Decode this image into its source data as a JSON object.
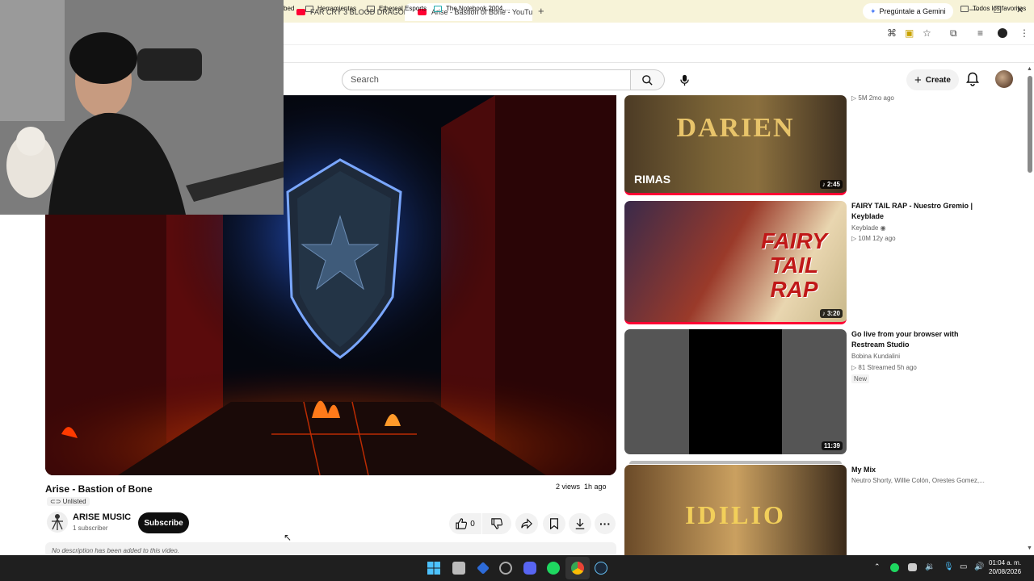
{
  "browser": {
    "tabs": [
      {
        "label": "FAR CRY 3 BLOOD DRAGON Ga",
        "active": false
      },
      {
        "label": "Arise - Bastion of Bone - YouTu",
        "active": true
      }
    ],
    "gemini_button": "Pregúntale a Gemini",
    "bookmarks": [
      "bed",
      "Herramientas",
      "Ethereal Esports",
      "The.Notebook.2004...."
    ],
    "all_bookmarks": "Todos los favoritos"
  },
  "youtube": {
    "search_placeholder": "Search",
    "create_label": "Create"
  },
  "video": {
    "title": "Arise - Bastion of Bone",
    "views": "2 views",
    "age": "1h ago",
    "visibility": "Unlisted",
    "channel": "ARISE MUSIC",
    "subscribers": "1 subscriber",
    "subscribe_label": "Subscribe",
    "likes": "0",
    "description": "No description has been added to this video."
  },
  "recommendations": [
    {
      "thumb_text": "DARIEN",
      "thumb_sub": "RIMAS",
      "duration": "2:45",
      "title": "",
      "channel": "",
      "meta": "5M  2mo ago"
    },
    {
      "thumb_text": "FAIRY TAIL RAP",
      "duration": "3:20",
      "title": "FAIRY TAIL RAP - Nuestro Gremio | Keyblade",
      "channel": "Keyblade",
      "meta": "10M  12y ago"
    },
    {
      "duration": "11:39",
      "title": "Go live from your browser with Restream Studio",
      "channel": "Bobina Kundalini",
      "meta": "81  Streamed 5h ago",
      "badge": "New"
    },
    {
      "thumb_text": "IDILIO",
      "title": "My Mix",
      "channel": "Neutro Shorty, Willie Colón, Orestes Gomez,..."
    }
  ],
  "taskbar": {
    "time": "01:04 a. m.",
    "date": "20/08/2026"
  },
  "colors": {
    "youtube_red": "#ff0033",
    "tabbar": "#f7f3d8"
  }
}
